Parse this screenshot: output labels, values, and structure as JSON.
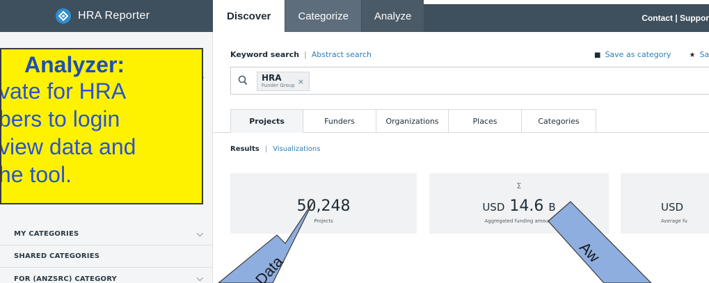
{
  "app": {
    "brand": "HRA Reporter",
    "tabs": [
      "Discover",
      "Categorize",
      "Analyze"
    ],
    "top_links": "Contact | Suppor"
  },
  "search": {
    "keyword_label": "Keyword search",
    "abstract_link": "Abstract search",
    "save_as_category": "Save as category",
    "save_cut": "Sa",
    "chip_title": "HRA",
    "chip_sub": "Funder Group",
    "chip_remove": "×"
  },
  "sub_tabs": [
    "Projects",
    "Funders",
    "Organizations",
    "Places",
    "Categories"
  ],
  "results": {
    "results_label": "Results",
    "visualizations_link": "Visualizations"
  },
  "stats": [
    {
      "value": "50,248",
      "caption": "Projects"
    },
    {
      "sigma": "Σ",
      "currency": "USD",
      "value": "14.6",
      "unit": "B",
      "caption": "Aggregated funding amount"
    },
    {
      "currency": "USD",
      "value": "",
      "caption": "Average fu"
    }
  ],
  "sidebar": {
    "items": [
      "MY CATEGORIES",
      "SHARED CATEGORIES",
      "FOR (ANZSRC) CATEGORY"
    ]
  },
  "callout": {
    "lines": [
      "Analyzer:",
      "vate for HRA",
      "bers to login",
      "view data and",
      "he tool."
    ]
  },
  "arrows": {
    "left_label": "Data",
    "right_label": "Aw"
  },
  "colors": {
    "header_dark": "#3e4f5d",
    "accent_link": "#2e7db6",
    "callout_fill": "#fff200",
    "arrow_fill": "#8faee0"
  }
}
